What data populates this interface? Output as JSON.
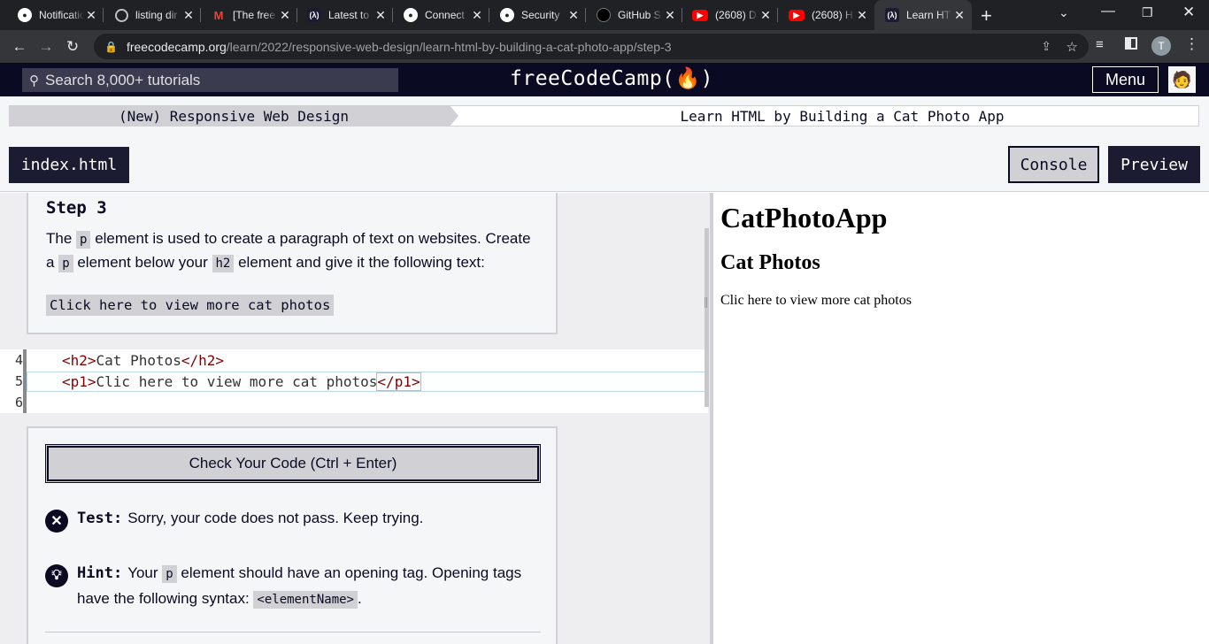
{
  "browser": {
    "tabs": [
      {
        "title": "Notifications",
        "icon": "github-icon"
      },
      {
        "title": "listing dir",
        "icon": "globe-icon"
      },
      {
        "title": "[The free",
        "icon": "gmail-icon"
      },
      {
        "title": "Latest to",
        "icon": "freecodecamp-icon"
      },
      {
        "title": "Connect",
        "icon": "github-icon"
      },
      {
        "title": "Security",
        "icon": "github-icon"
      },
      {
        "title": "GitHub S",
        "icon": "github-dark-icon"
      },
      {
        "title": "(2608) D",
        "icon": "youtube-icon"
      },
      {
        "title": "(2608) H",
        "icon": "youtube-icon"
      },
      {
        "title": "Learn HT",
        "icon": "freecodecamp-icon"
      }
    ],
    "url_host": "freecodecamp.org",
    "url_path": "/learn/2022/responsive-web-design/learn-html-by-building-a-cat-photo-app/step-3",
    "profile_initial": "T"
  },
  "nav": {
    "search_placeholder": "Search 8,000+ tutorials",
    "logo": "freeCodeCamp(🔥)",
    "menu_label": "Menu"
  },
  "breadcrumb": {
    "superblock": "(New) Responsive Web Design",
    "block": "Learn HTML by Building a Cat Photo App"
  },
  "editor_tabs": {
    "file": "index.html",
    "console": "Console",
    "preview": "Preview"
  },
  "step": {
    "title": "Step 3",
    "desc_1a": "The ",
    "desc_code1": "p",
    "desc_1b": " element is used to create a paragraph of text on websites. Create",
    "desc_2a": "a ",
    "desc_code2": "p",
    "desc_2b": " element below your ",
    "desc_code3": "h2",
    "desc_2c": " element and give it the following text:",
    "code_text": "Click here to view more cat photos"
  },
  "code_lines": [
    {
      "num": "4",
      "parts": [
        "<h2>",
        "Cat Photos",
        "</h2>"
      ]
    },
    {
      "num": "5",
      "parts": [
        "<p1>",
        "Clic here to view more cat photos",
        "</p1>"
      ]
    },
    {
      "num": "6",
      "parts": [
        "",
        "",
        ""
      ]
    }
  ],
  "tests": {
    "check_button": "Check Your Code (Ctrl + Enter)",
    "test_label": "Test:",
    "test_text": "Sorry, your code does not pass. Keep trying.",
    "hint_label": "Hint:",
    "hint_a": "Your ",
    "hint_code1": "p",
    "hint_b": " element should have an opening tag. Opening tags",
    "hint_c": "have the following syntax: ",
    "hint_code2": "<elementName>",
    "hint_d": "."
  },
  "preview": {
    "h1": "CatPhotoApp",
    "h2": "Cat Photos",
    "p": "Clic here to view more cat photos"
  },
  "colors": {
    "nav_bg": "#0a0a23",
    "panel_bg": "#f5f6f7",
    "accent_dark": "#1b1b32",
    "tag_color": "#800000"
  }
}
